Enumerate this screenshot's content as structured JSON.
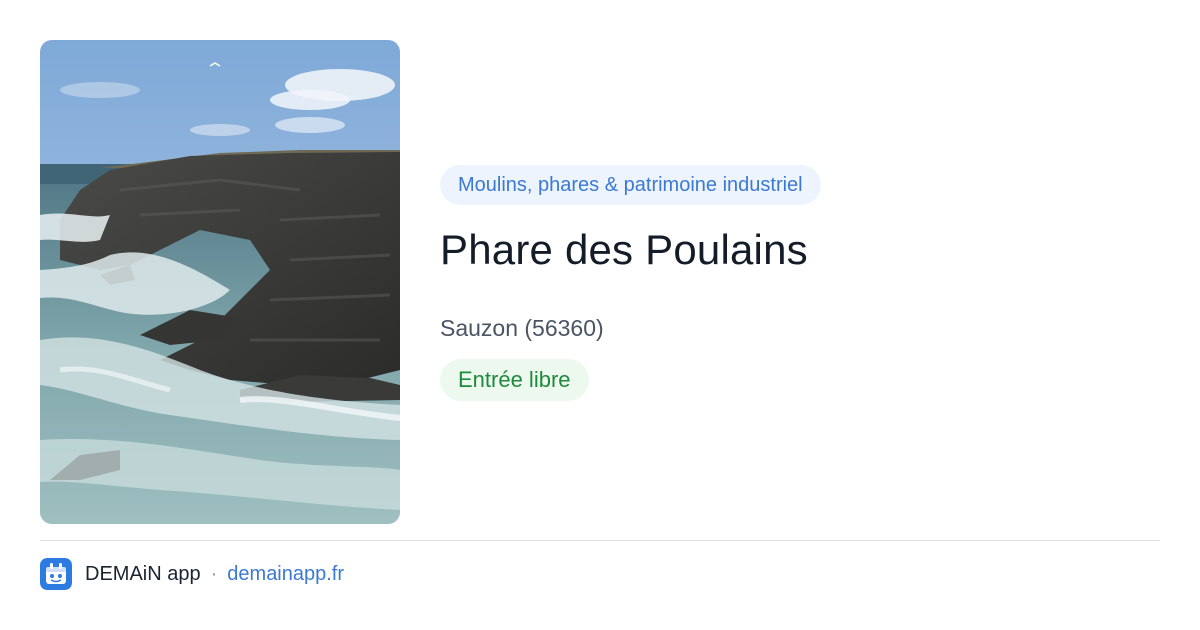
{
  "place": {
    "category": "Moulins, phares & patrimoine industriel",
    "title": "Phare des Poulains",
    "location": "Sauzon (56360)",
    "access": "Entrée libre"
  },
  "footer": {
    "app_name": "DEMAiN app",
    "separator": "·",
    "link": "demainapp.fr"
  },
  "colors": {
    "accent": "#3b79d4",
    "category_bg": "#eef4fd",
    "access_text": "#1f8a3c",
    "access_bg": "#edf9ef",
    "title": "#141c28"
  },
  "icons": {
    "app": "demain-logo-icon"
  }
}
